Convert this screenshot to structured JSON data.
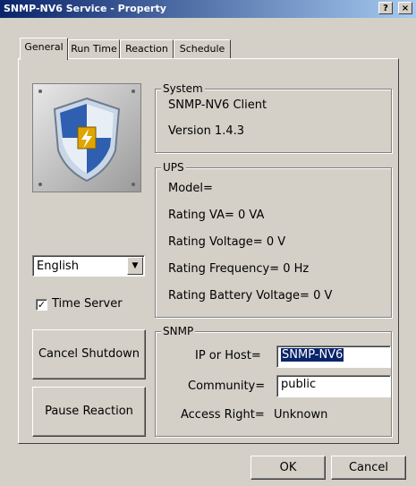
{
  "window": {
    "title": "SNMP-NV6 Service - Property",
    "help_label": "?",
    "close_label": "×"
  },
  "tabs": [
    {
      "label": "General",
      "active": true
    },
    {
      "label": "Run Time",
      "active": false
    },
    {
      "label": "Reaction",
      "active": false
    },
    {
      "label": "Schedule",
      "active": false
    }
  ],
  "icons": {
    "shield": "shield-logo-icon",
    "dropdown": "chevron-down-icon",
    "check": "checkmark-icon"
  },
  "system": {
    "label": "System",
    "name": "SNMP-NV6 Client",
    "version": "Version 1.4.3"
  },
  "ups": {
    "label": "UPS",
    "model": "Model=",
    "rating_va": "Rating VA= 0 VA",
    "rating_voltage": "Rating Voltage= 0 V",
    "rating_frequency": "Rating Frequency= 0 Hz",
    "rating_battery_voltage": "Rating Battery Voltage= 0 V"
  },
  "language": {
    "selected": "English"
  },
  "time_server": {
    "label": "Time Server",
    "checked": true
  },
  "buttons": {
    "cancel_shutdown": "Cancel Shutdown",
    "pause_reaction": "Pause Reaction",
    "ok": "OK",
    "cancel": "Cancel"
  },
  "snmp": {
    "label": "SNMP",
    "ip_label": "IP or Host=",
    "ip_value": "SNMP-NV6",
    "community_label": "Community=",
    "community_value": "public",
    "access_label": "Access Right=",
    "access_value": "Unknown"
  },
  "colors": {
    "title_bar": "#0a246a",
    "face": "#d4d0c8",
    "selection": "#0a246a"
  }
}
